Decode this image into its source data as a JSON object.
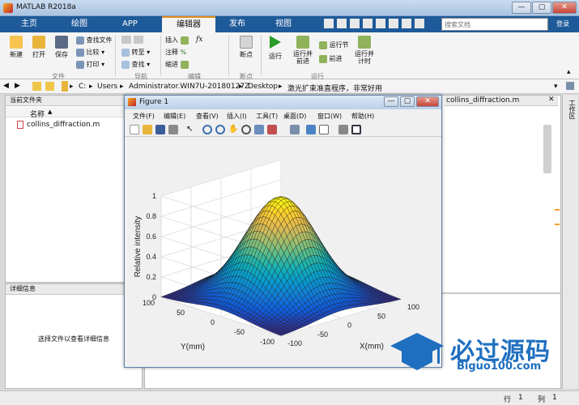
{
  "app": {
    "title": "MATLAB R2018a",
    "search_placeholder": "搜索文档"
  },
  "window_controls": [
    "—",
    "▢",
    "✕"
  ],
  "tabs": [
    "主页",
    "绘图",
    "APP",
    "编辑器",
    "发布",
    "视图"
  ],
  "ribbon": {
    "file": {
      "new": "新建",
      "open": "打开",
      "save": "保存",
      "find_files": "查找文件",
      "compare": "比较",
      "print": "打印",
      "group": "文件"
    },
    "nav": {
      "goto": "转至",
      "find": "查找",
      "group": "导航"
    },
    "edit": {
      "insert": "插入",
      "comment": "注释",
      "indent": "缩进",
      "fx": "fx",
      "group": "编辑"
    },
    "breakpoint": {
      "label": "断点",
      "group": "断点"
    },
    "run": {
      "run": "运行",
      "run_advance": "运行并\n前进",
      "run_section": "运行节",
      "advance": "前进",
      "run_time": "运行并\n计时",
      "group": "运行"
    }
  },
  "path": {
    "segments": [
      "C:",
      "Users",
      "Administrator.WIN7U-20180127Z",
      "Desktop",
      "激光扩束准直程序，非常好用"
    ]
  },
  "current_folder": {
    "title": "当前文件夹",
    "col_name": "名称",
    "files": [
      "collins_diffraction.m"
    ]
  },
  "details": {
    "title": "详细信息",
    "empty": "选择文件以查看详细信息"
  },
  "editor_tab": "collins_diffraction.m",
  "workspace_label": "工作区",
  "figure": {
    "title": "Figure 1",
    "menu": [
      "文件(F)",
      "编辑(E)",
      "查看(V)",
      "插入(I)",
      "工具(T)",
      "桌面(D)",
      "窗口(W)",
      "帮助(H)"
    ],
    "controls": [
      "—",
      "▢",
      "✕"
    ]
  },
  "chart_data": {
    "type": "surface",
    "x": {
      "label": "X(mm)",
      "ticks": [
        -100,
        -50,
        0,
        50,
        100
      ],
      "range": [
        -100,
        100
      ]
    },
    "y": {
      "label": "Y(mm)",
      "ticks": [
        -100,
        -50,
        0,
        50,
        100
      ],
      "range": [
        -100,
        100
      ]
    },
    "z": {
      "label": "Relative intensity",
      "ticks": [
        0,
        0.2,
        0.4,
        0.6,
        0.8,
        1
      ],
      "range": [
        0,
        1
      ]
    },
    "function": "gaussian",
    "peak": 1,
    "grid": true,
    "colormap": "parula"
  },
  "watermark": {
    "text": "必过源码",
    "url": "Biguo100.com"
  },
  "statusbar": {
    "row_label": "行",
    "row": "1",
    "col_label": "列",
    "col": "1"
  }
}
